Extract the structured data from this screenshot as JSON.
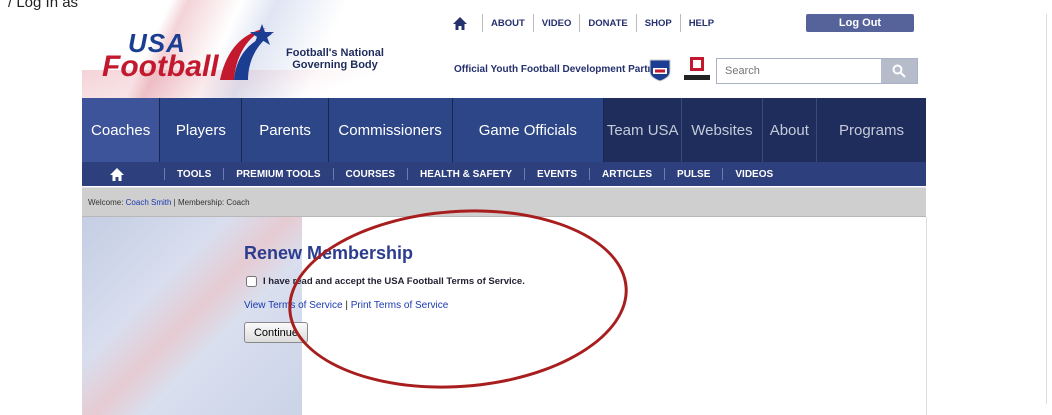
{
  "note": "/ Log In as a Coach and Go to the Renew Membership Page",
  "brand": {
    "logo_top": "USA",
    "logo_bottom": "Football",
    "tagline": "Football's National\nGoverning Body"
  },
  "util_nav": [
    "ABOUT",
    "VIDEO",
    "DONATE",
    "SHOP",
    "HELP"
  ],
  "logout_label": "Log Out",
  "partner_text": "Official Youth Football Development Partner",
  "search": {
    "placeholder": "Search"
  },
  "main_nav": [
    {
      "label": "Coaches"
    },
    {
      "label": "Players"
    },
    {
      "label": "Parents"
    },
    {
      "label": "Commissioners"
    },
    {
      "label": "Game Officials"
    },
    {
      "label": "Team USA"
    },
    {
      "label": "Websites"
    },
    {
      "label": "About"
    },
    {
      "label": "Programs"
    }
  ],
  "sub_nav": [
    "TOOLS",
    "PREMIUM TOOLS",
    "COURSES",
    "HEALTH & SAFETY",
    "EVENTS",
    "ARTICLES",
    "PULSE",
    "VIDEOS"
  ],
  "welcome": {
    "prefix": "Welcome: ",
    "user": "Coach Smith",
    "suffix": " | Membership: Coach"
  },
  "renew": {
    "title": "Renew Membership",
    "accept_label": "I have read and accept the USA Football Terms of Service.",
    "view_link": "View Terms of Service",
    "link_sep": " | ",
    "print_link": "Print Terms of Service",
    "continue_label": "Continue"
  },
  "colors": {
    "nav_bg": "#23356a",
    "active_nav": "#3d539a",
    "title": "#2c3d8f",
    "annotation": "#a81e1e"
  }
}
